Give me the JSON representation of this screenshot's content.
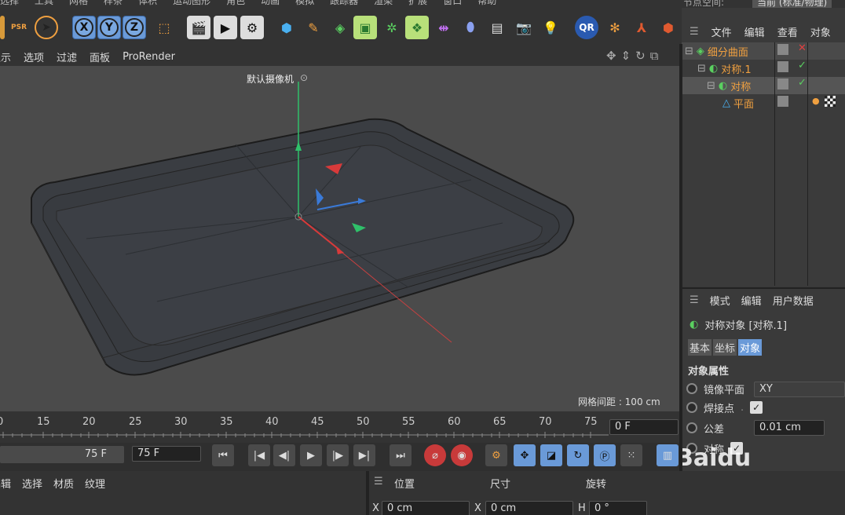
{
  "menubar": {
    "items": [
      "选择",
      "工具",
      "网格",
      "样条",
      "体积",
      "运动图形",
      "角色",
      "动画",
      "模拟",
      "跟踪器",
      "渲染",
      "扩展",
      "窗口",
      "帮助"
    ],
    "node_space_label": "节点空间:",
    "node_space_value": "当前 (标准/物理)"
  },
  "toolbar": {
    "x_label": "X",
    "y_label": "Y",
    "z_label": "Z",
    "qr_label": "QR",
    "psr_label": "PSR"
  },
  "viewport": {
    "menu": [
      "显示",
      "选项",
      "过滤",
      "面板",
      "ProRender"
    ],
    "camera_label": "默认摄像机",
    "grid_spacing": "网格间距 : 100 cm"
  },
  "object_manager": {
    "tabs": [
      "文件",
      "编辑",
      "查看",
      "对象"
    ],
    "objects": [
      {
        "name": "细分曲面",
        "status": "✕"
      },
      {
        "name": "对称.1",
        "status": "✓"
      },
      {
        "name": "对称",
        "status": "✓"
      },
      {
        "name": "平面",
        "status": ""
      }
    ]
  },
  "attributes": {
    "tabs": [
      "模式",
      "编辑",
      "用户数据"
    ],
    "object_title": "对称对象 [对称.1]",
    "subtabs": [
      "基本",
      "坐标",
      "对象"
    ],
    "section_title": "对象属性",
    "mirror_plane_label": "镜像平面",
    "mirror_plane_value": "XY",
    "weld_label": "焊接点",
    "tolerance_label": "公差",
    "tolerance_value": "0.01 cm",
    "symmetry_label": "对称"
  },
  "timeline": {
    "ticks": [
      "0",
      "15",
      "20",
      "25",
      "30",
      "35",
      "40",
      "45",
      "50",
      "55",
      "60",
      "65",
      "70",
      "75"
    ],
    "current_frame": "0 F"
  },
  "transport": {
    "end_frame_display": "75 F",
    "end_frame_field": "75 F"
  },
  "material_manager": {
    "menu": [
      "编辑",
      "选择",
      "材质",
      "纹理"
    ]
  },
  "coordinates": {
    "headers": [
      "位置",
      "尺寸",
      "旋转"
    ],
    "x_label": "X",
    "pos_x": "0 cm",
    "x2_label": "X",
    "size_x": "0 cm",
    "h_label": "H",
    "rot_h": "0 °"
  },
  "watermark": {
    "text": "Baidu"
  },
  "colors": {
    "accent_blue": "#6a9ad8",
    "object_orange": "#f0a040",
    "axis_green": "#2fc06a",
    "axis_red": "#d83a3a",
    "axis_blue": "#3a7ad8"
  }
}
